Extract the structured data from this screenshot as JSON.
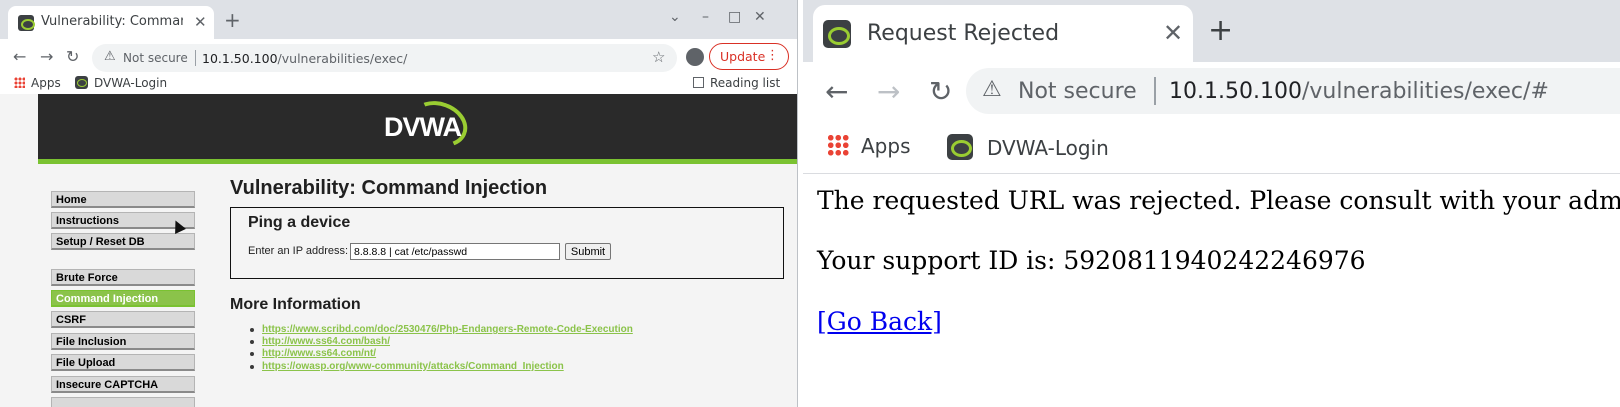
{
  "left_window": {
    "tab_title": "Vulnerability: Command Inj",
    "address_bar": {
      "security_label": "Not secure",
      "url_host": "10.1.50.100",
      "url_path": "/vulnerabilities/exec/"
    },
    "update_button": "Update",
    "bookmarks": {
      "apps": "Apps",
      "dvwa_login": "DVWA-Login",
      "reading_list": "Reading list"
    },
    "dvwa": {
      "logo_text": "DVWA",
      "menu": [
        "Home",
        "Instructions",
        "Setup / Reset DB",
        "Brute Force",
        "Command Injection",
        "CSRF",
        "File Inclusion",
        "File Upload",
        "Insecure CAPTCHA"
      ],
      "active_menu_item": "Command Injection",
      "page_title": "Vulnerability: Command Injection",
      "ping_title": "Ping a device",
      "ip_label": "Enter an IP address:",
      "ip_value": "8.8.8.8 | cat /etc/passwd",
      "submit_label": "Submit",
      "more_info_title": "More Information",
      "links": [
        "https://www.scribd.com/doc/2530476/Php-Endangers-Remote-Code-Execution",
        "http://www.ss64.com/bash/",
        "http://www.ss64.com/nt/",
        "https://owasp.org/www-community/attacks/Command_Injection"
      ]
    }
  },
  "right_window": {
    "tab_title": "Request Rejected",
    "address_bar": {
      "security_label": "Not secure",
      "url_host": "10.1.50.100",
      "url_path": "/vulnerabilities/exec/#"
    },
    "bookmarks": {
      "apps": "Apps",
      "dvwa_login": "DVWA-Login"
    },
    "message": "The requested URL was rejected. Please consult with your administrator.",
    "support_id": "Your support ID is: 5920811940242246976",
    "go_back_label": "[Go Back]"
  },
  "colors": {
    "dvwa_green": "#8bc34a",
    "update_red": "#d93025",
    "link_blue": "#0000ee"
  }
}
